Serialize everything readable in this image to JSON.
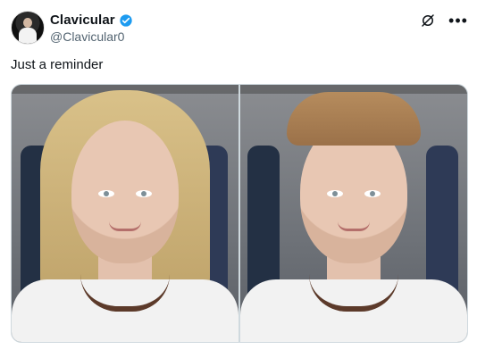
{
  "tweet": {
    "display_name": "Clavicular",
    "handle": "@Clavicular0",
    "text": "Just a reminder",
    "verified": true
  },
  "icons": {
    "verified": "verified-badge-icon",
    "grok": "grok-icon",
    "more": "more-icon"
  },
  "colors": {
    "verified_blue": "#1d9bf0",
    "handle_gray": "#536471",
    "text": "#0f1419",
    "border": "#cfd9de"
  }
}
